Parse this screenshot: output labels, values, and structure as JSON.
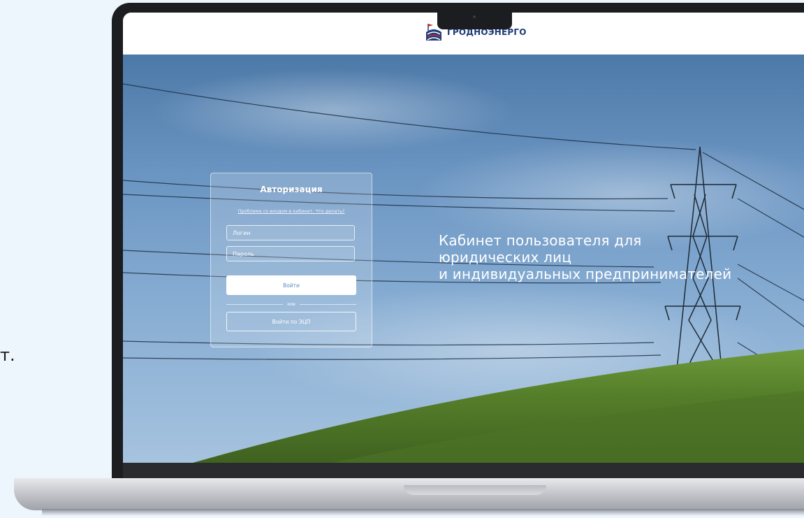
{
  "side_caption": "т.",
  "site": {
    "logo_text": "ГРОДНОЭНЕРГО",
    "brand_colors": {
      "blue": "#1f3c7a",
      "red": "#d62b2b"
    }
  },
  "hero": {
    "title_lines": [
      "Кабинет пользователя для",
      "юридических лиц",
      "и индивидуальных предпринимателей"
    ]
  },
  "auth": {
    "title": "Авторизация",
    "help_link": "Проблема со входом в кабинет. Что делать?",
    "login_placeholder": "Логин",
    "password_placeholder": "Пароль",
    "login_button": "Войти",
    "or_text": "или",
    "ecp_button": "Войти по ЭЦП",
    "accent_color": "#5e8bc2"
  }
}
